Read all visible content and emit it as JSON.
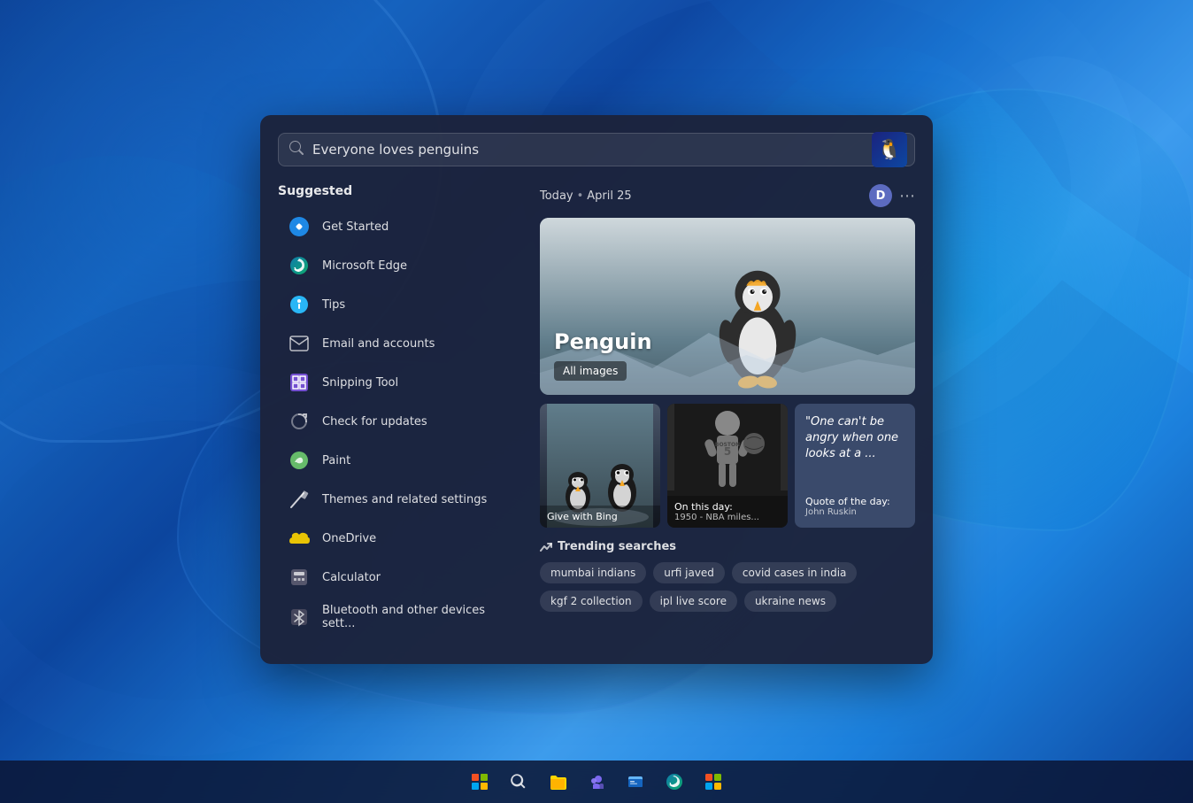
{
  "desktop": {
    "bg_description": "Windows 11 blue abstract wallpaper"
  },
  "search": {
    "placeholder": "Everyone loves penguins",
    "value": "Everyone loves penguins"
  },
  "suggested": {
    "title": "Suggested",
    "items": [
      {
        "id": "get-started",
        "label": "Get Started",
        "icon": "🚀",
        "icon_type": "get-started"
      },
      {
        "id": "microsoft-edge",
        "label": "Microsoft Edge",
        "icon": "🌐",
        "icon_type": "edge"
      },
      {
        "id": "tips",
        "label": "Tips",
        "icon": "💡",
        "icon_type": "tips"
      },
      {
        "id": "email-accounts",
        "label": "Email and accounts",
        "icon": "✉",
        "icon_type": "email"
      },
      {
        "id": "snipping-tool",
        "label": "Snipping Tool",
        "icon": "✂",
        "icon_type": "snipping"
      },
      {
        "id": "check-updates",
        "label": "Check for updates",
        "icon": "🔄",
        "icon_type": "updates"
      },
      {
        "id": "paint",
        "label": "Paint",
        "icon": "🎨",
        "icon_type": "paint"
      },
      {
        "id": "themes",
        "label": "Themes and related settings",
        "icon": "✏",
        "icon_type": "themes"
      },
      {
        "id": "onedrive",
        "label": "OneDrive",
        "icon": "☁",
        "icon_type": "onedrive"
      },
      {
        "id": "calculator",
        "label": "Calculator",
        "icon": "🔢",
        "icon_type": "calculator"
      },
      {
        "id": "bluetooth",
        "label": "Bluetooth and other devices sett...",
        "icon": "📡",
        "icon_type": "bluetooth"
      }
    ]
  },
  "today": {
    "label": "Today",
    "dot": "•",
    "date": "April 25",
    "avatar_initial": "D",
    "hero": {
      "title": "Penguin",
      "badge": "All images"
    },
    "cards": [
      {
        "id": "give-bing",
        "label": "Give with Bing",
        "sublabel": ""
      },
      {
        "id": "on-this-day",
        "label": "On this day:",
        "sublabel": "1950 - NBA miles..."
      },
      {
        "id": "quote-day",
        "label": "Quote of the day:",
        "sublabel": "John Ruskin",
        "quote": "\"One can't be angry when one looks at a ..."
      }
    ],
    "trending": {
      "title": "Trending searches",
      "tags": [
        "mumbai indians",
        "urfi javed",
        "covid cases in india",
        "kgf 2 collection",
        "ipl live score",
        "ukraine news"
      ]
    }
  },
  "taskbar": {
    "items": [
      {
        "id": "start",
        "label": "Start",
        "icon": "windows"
      },
      {
        "id": "search",
        "label": "Search",
        "icon": "🔍"
      },
      {
        "id": "files",
        "label": "File Explorer",
        "icon": "📁"
      },
      {
        "id": "teams",
        "label": "Teams",
        "icon": "👥"
      },
      {
        "id": "file-manager",
        "label": "File Manager",
        "icon": "📂"
      },
      {
        "id": "edge",
        "label": "Microsoft Edge",
        "icon": "🌐"
      },
      {
        "id": "store",
        "label": "Microsoft Store",
        "icon": "🏪"
      }
    ]
  }
}
